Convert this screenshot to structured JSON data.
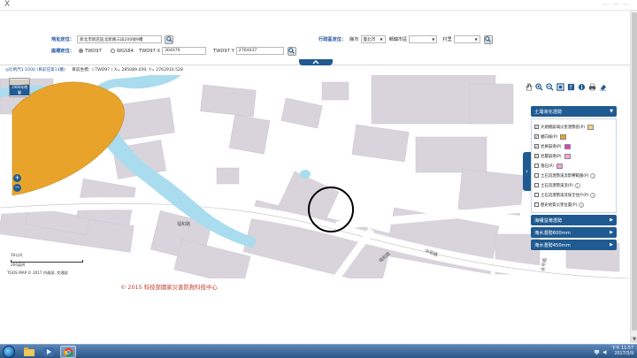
{
  "window": {
    "close_glyph": "X"
  },
  "address_search": {
    "label": "地址定位：",
    "value": "新北市新店區北新路三段200號9樓"
  },
  "coord_search": {
    "label": "座標定位：",
    "options": [
      "TWD97",
      "WGS84"
    ],
    "selected": "TWD97",
    "x_label": "TWD97 X",
    "x_value": "304679",
    "y_label": "TWD97 Y",
    "y_value": "2764037"
  },
  "admin_search": {
    "label": "行政區定位：",
    "county_label": "縣市",
    "county_value": "臺北市",
    "town_label": "鄉鎮市區",
    "town_value": "",
    "village_label": "村里",
    "village_value": ""
  },
  "status": {
    "scale_text": "◎比例尺1:1000 (目前在第13層)",
    "coords_text": "目前坐標：( TWD97 ) X= 285089.439, Y= 2762910.528"
  },
  "map": {
    "thumb_label": "1906年地圖",
    "zoom_in": "+",
    "zoom_out": "−",
    "scalebar_top": "50公尺",
    "scalebar_bottom": "200英呎",
    "road_labels": [
      "福和路",
      "福和路",
      "中和路",
      "永亨路"
    ],
    "copyright": "TGOS MAP © 2017 內政部, 交通部",
    "colors": {
      "hazard_orange": "#E8A42A",
      "river": "#A9DCEE",
      "building": "#D7D2D9",
      "road": "#ffffff",
      "marker": "#000000"
    }
  },
  "toolbar": {
    "icons": [
      "hand-icon",
      "zoom-in-icon",
      "zoom-out-icon",
      "fullscreen-icon",
      "layers-icon",
      "info-icon",
      "print-icon",
      "eraser-icon"
    ]
  },
  "layer_panel": {
    "section1_title": "土壤液化潛勢",
    "items": [
      {
        "label": "大規模崩塌災害潛勢區(P)",
        "checked": true,
        "color": "#F4D27A"
      },
      {
        "label": "順向坡(P)",
        "checked": true,
        "color": "#E8A42A"
      },
      {
        "label": "岩屑崩滑(P)",
        "checked": true,
        "color": "#E040C0"
      },
      {
        "label": "岩層崩滑(P)",
        "checked": true,
        "color": "#F3A6D6"
      },
      {
        "label": "落石(P)",
        "checked": false,
        "color": "#F0A0D8"
      },
      {
        "label": "土石流潛勢溪流影響範圍(P)",
        "checked": false,
        "color": ""
      },
      {
        "label": "土石流潛勢溪流(P)",
        "checked": false,
        "color": ""
      },
      {
        "label": "土石流潛勢溪流保全住戶(P)",
        "checked": false,
        "color": ""
      },
      {
        "label": "歷史地質災害位置(P)",
        "checked": false,
        "color": ""
      }
    ],
    "section2_title": "海嘯溢淹潛勢",
    "section3_title": "淹水潛勢600mm",
    "section4_title": "淹水潛勢450mm"
  },
  "credit": "© 2015 科技部國家災害防救科技中心",
  "taskbar": {
    "time": "下午 11:57",
    "date": "2017/3/9"
  }
}
